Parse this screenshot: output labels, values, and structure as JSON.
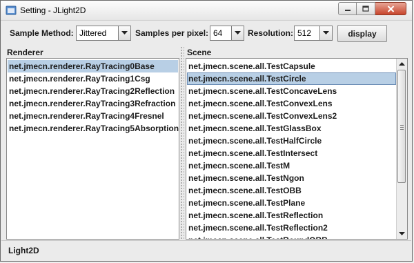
{
  "window": {
    "title": "Setting - JLight2D",
    "controls": [
      "minimize",
      "maximize",
      "close"
    ]
  },
  "toolbar": {
    "sample_method_label": "Sample Method:",
    "sample_method_value": "Jittered",
    "samples_label": "Samples per pixel:",
    "samples_value": "64",
    "resolution_label": "Resolution:",
    "resolution_value": "512",
    "display_label": "display"
  },
  "renderer": {
    "header": "Renderer",
    "selected_index": 0,
    "items": [
      "net.jmecn.renderer.RayTracing0Base",
      "net.jmecn.renderer.RayTracing1Csg",
      "net.jmecn.renderer.RayTracing2Reflection",
      "net.jmecn.renderer.RayTracing3Refraction",
      "net.jmecn.renderer.RayTracing4Fresnel",
      "net.jmecn.renderer.RayTracing5Absorption"
    ]
  },
  "scene": {
    "header": "Scene",
    "selected_index": 1,
    "items": [
      "net.jmecn.scene.all.TestCapsule",
      "net.jmecn.scene.all.TestCircle",
      "net.jmecn.scene.all.TestConcaveLens",
      "net.jmecn.scene.all.TestConvexLens",
      "net.jmecn.scene.all.TestConvexLens2",
      "net.jmecn.scene.all.TestGlassBox",
      "net.jmecn.scene.all.TestHalfCircle",
      "net.jmecn.scene.all.TestIntersect",
      "net.jmecn.scene.all.TestM",
      "net.jmecn.scene.all.TestNgon",
      "net.jmecn.scene.all.TestOBB",
      "net.jmecn.scene.all.TestPlane",
      "net.jmecn.scene.all.TestReflection",
      "net.jmecn.scene.all.TestReflection2",
      "net.jmecn.scene.all.TestRoundOBB"
    ]
  },
  "status": {
    "text": "Light2D"
  },
  "colors": {
    "selection": "#b8cfe5",
    "close_button": "#c7452c"
  }
}
